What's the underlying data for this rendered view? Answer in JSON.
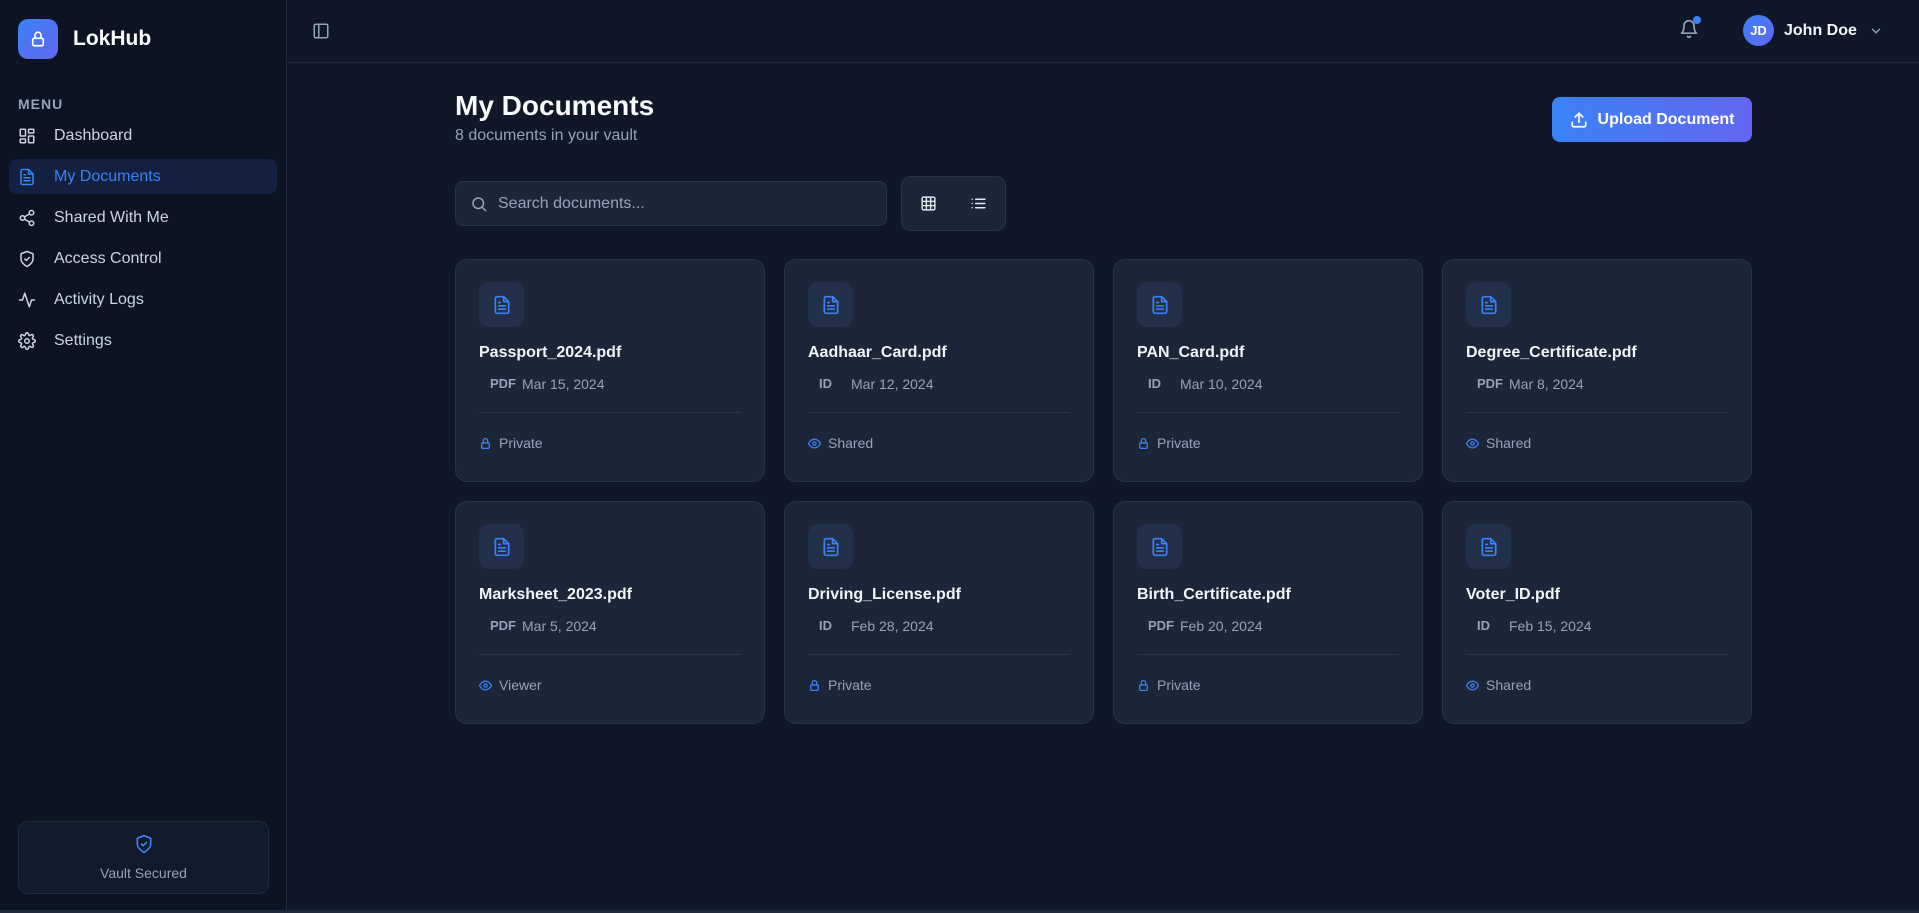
{
  "brand": {
    "name": "LokHub",
    "logo_icon": "lock-icon"
  },
  "sidebar": {
    "menu_heading": "MENU",
    "items": [
      {
        "label": "Dashboard",
        "icon": "dashboard-icon",
        "active": false
      },
      {
        "label": "My Documents",
        "icon": "document-icon",
        "active": true
      },
      {
        "label": "Shared With Me",
        "icon": "share-icon",
        "active": false
      },
      {
        "label": "Access Control",
        "icon": "shield-icon",
        "active": false
      },
      {
        "label": "Activity Logs",
        "icon": "activity-icon",
        "active": false
      },
      {
        "label": "Settings",
        "icon": "gear-icon",
        "active": false
      }
    ],
    "vault_status": "Vault Secured"
  },
  "header": {
    "user": {
      "initials": "JD",
      "name": "John Doe"
    },
    "notification_dot": true
  },
  "page": {
    "title": "My Documents",
    "subtitle": "8 documents in your vault",
    "upload_label": "Upload Document",
    "search_placeholder": "Search documents...",
    "view_mode": "grid"
  },
  "documents": [
    {
      "name": "Passport_2024.pdf",
      "type": "PDF",
      "date": "Mar 15, 2024",
      "access": "Private"
    },
    {
      "name": "Aadhaar_Card.pdf",
      "type": "ID",
      "date": "Mar 12, 2024",
      "access": "Shared"
    },
    {
      "name": "PAN_Card.pdf",
      "type": "ID",
      "date": "Mar 10, 2024",
      "access": "Private"
    },
    {
      "name": "Degree_Certificate.pdf",
      "type": "PDF",
      "date": "Mar 8, 2024",
      "access": "Shared"
    },
    {
      "name": "Marksheet_2023.pdf",
      "type": "PDF",
      "date": "Mar 5, 2024",
      "access": "Viewer"
    },
    {
      "name": "Driving_License.pdf",
      "type": "ID",
      "date": "Feb 28, 2024",
      "access": "Private"
    },
    {
      "name": "Birth_Certificate.pdf",
      "type": "PDF",
      "date": "Feb 20, 2024",
      "access": "Private"
    },
    {
      "name": "Voter_ID.pdf",
      "type": "ID",
      "date": "Feb 15, 2024",
      "access": "Shared"
    }
  ],
  "colors": {
    "accent": "#3b82f6",
    "accent_2": "#6366f1",
    "background": "#0f1729",
    "card": "#1c2638"
  }
}
